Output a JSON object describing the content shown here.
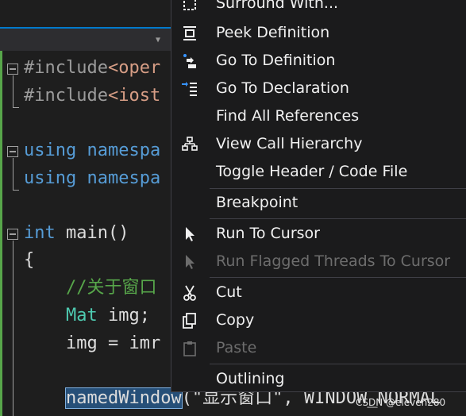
{
  "editor": {
    "lines": [
      {
        "tokens": [
          {
            "t": "#include",
            "c": "pp"
          },
          {
            "t": "<oper",
            "c": "inc"
          }
        ]
      },
      {
        "tokens": [
          {
            "t": "#include",
            "c": "pp"
          },
          {
            "t": "<iost",
            "c": "inc"
          }
        ]
      },
      {
        "tokens": [
          {
            "t": "using",
            "c": "kw"
          },
          {
            "t": " ",
            "c": "plain"
          },
          {
            "t": "namespa",
            "c": "kw"
          }
        ]
      },
      {
        "tokens": [
          {
            "t": "using",
            "c": "kw"
          },
          {
            "t": " ",
            "c": "plain"
          },
          {
            "t": "namespa",
            "c": "kw"
          }
        ]
      },
      {
        "tokens": [
          {
            "t": "int",
            "c": "kw"
          },
          {
            "t": " main()",
            "c": "plain"
          }
        ]
      },
      {
        "tokens": [
          {
            "t": "{",
            "c": "plain"
          }
        ]
      },
      {
        "tokens": [
          {
            "t": "    //关于窗口",
            "c": "cm"
          }
        ]
      },
      {
        "tokens": [
          {
            "t": "    ",
            "c": "plain"
          },
          {
            "t": "Mat",
            "c": "ty"
          },
          {
            "t": " img;",
            "c": "plain"
          }
        ]
      },
      {
        "tokens": [
          {
            "t": "    img = imr",
            "c": "plain"
          }
        ]
      },
      {
        "tokens": [
          {
            "t": "    ",
            "c": "plain"
          },
          {
            "t": "namedWindow",
            "c": "hl"
          },
          {
            "t": "(\"显示窗口\", WINDOW_NORMAL",
            "c": "plain"
          }
        ]
      }
    ],
    "watermark": "CSDN @eleven280"
  },
  "context_menu": {
    "items": [
      {
        "label": "Surround With...",
        "icon": "surround-with-icon",
        "enabled": true
      },
      {
        "label": "Peek Definition",
        "icon": "peek-definition-icon",
        "enabled": true
      },
      {
        "label": "Go To Definition",
        "icon": "go-to-definition-icon",
        "enabled": true
      },
      {
        "label": "Go To Declaration",
        "icon": "go-to-declaration-icon",
        "enabled": true
      },
      {
        "label": "Find All References",
        "icon": "",
        "enabled": true
      },
      {
        "label": "View Call Hierarchy",
        "icon": "call-hierarchy-icon",
        "enabled": true
      },
      {
        "label": "Toggle Header / Code File",
        "icon": "",
        "enabled": true
      },
      {
        "label": "Breakpoint",
        "icon": "",
        "enabled": true
      },
      {
        "label": "Run To Cursor",
        "icon": "run-to-cursor-icon",
        "enabled": true
      },
      {
        "label": "Run Flagged Threads To Cursor",
        "icon": "run-flagged-threads-icon",
        "enabled": false
      },
      {
        "label": "Cut",
        "icon": "cut-icon",
        "enabled": true
      },
      {
        "label": "Copy",
        "icon": "copy-icon",
        "enabled": true
      },
      {
        "label": "Paste",
        "icon": "paste-icon",
        "enabled": false
      },
      {
        "label": "Outlining",
        "icon": "",
        "enabled": true
      }
    ]
  }
}
